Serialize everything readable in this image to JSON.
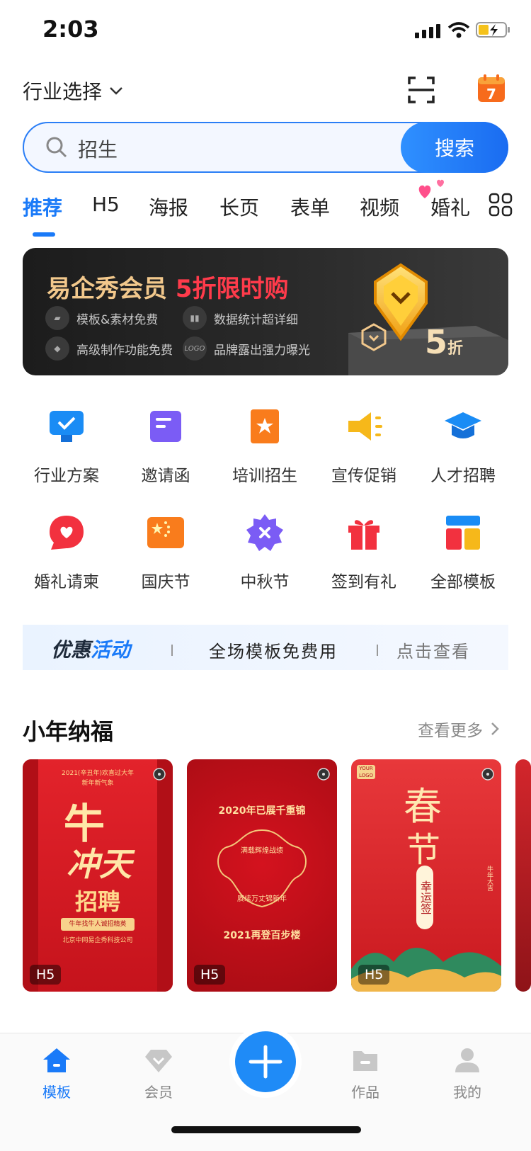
{
  "status_bar": {
    "time": "2:03"
  },
  "header": {
    "industry_label": "行业选择"
  },
  "calendar": {
    "day": "7"
  },
  "search": {
    "text": "招生",
    "button": "搜索"
  },
  "tabs": [
    "推荐",
    "H5",
    "海报",
    "长页",
    "表单",
    "视频",
    "婚礼"
  ],
  "banner": {
    "title": "易企秀会员",
    "highlight": "5折限时购",
    "features": [
      "模板&素材免费",
      "数据统计超详细",
      "高级制作功能免费",
      "品牌露出强力曝光"
    ],
    "logo_chip": "LOGO",
    "discount_number": "5",
    "discount_unit": "折"
  },
  "grid": [
    {
      "label": "行业方案",
      "icon": "monitor-check-icon",
      "color": "#1a8cf5"
    },
    {
      "label": "邀请函",
      "icon": "envelope-icon",
      "color": "#7b5cf5"
    },
    {
      "label": "培训招生",
      "icon": "star-book-icon",
      "color": "#f97c1c"
    },
    {
      "label": "宣传促销",
      "icon": "megaphone-icon",
      "color": "#f6b81a"
    },
    {
      "label": "人才招聘",
      "icon": "graduation-cap-icon",
      "color": "#1a8cf5"
    },
    {
      "label": "婚礼请柬",
      "icon": "heart-chat-icon",
      "color": "#f2313f"
    },
    {
      "label": "国庆节",
      "icon": "flag-icon",
      "color": "#f97c1c"
    },
    {
      "label": "中秋节",
      "icon": "flower-icon",
      "color": "#7b5cf5"
    },
    {
      "label": "签到有礼",
      "icon": "gift-icon",
      "color": "#f2313f"
    },
    {
      "label": "全部模板",
      "icon": "layout-icon",
      "color": "#1a8cf5"
    }
  ],
  "promo": {
    "tag_a": "优惠",
    "tag_b": "活动",
    "text": "全场模板免费用",
    "link": "点击查看"
  },
  "section": {
    "title": "小年纳福",
    "more": "查看更多"
  },
  "cards": [
    {
      "badge": "H5",
      "top": "2021(辛丑年)欢喜过大年",
      "sub": "新年新气象",
      "main_a": "牛",
      "main_b": "冲天",
      "hire": "招聘",
      "foot1": "牛年找牛人诚招精英",
      "foot2": "北京中网易企秀科技公司"
    },
    {
      "badge": "H5",
      "line1": "2020年已展千重锦",
      "center1": "满载辉煌战绩",
      "center2": "赓续万丈锦新年",
      "line2": "2021再登百步楼"
    },
    {
      "badge": "H5",
      "logo": "YOUR LOGO",
      "big_a": "春",
      "big_b": "节",
      "tag": "幸运签",
      "side": "牛年大吉"
    }
  ],
  "tabbar": [
    {
      "label": "模板",
      "icon": "home-icon",
      "active": true
    },
    {
      "label": "会员",
      "icon": "diamond-icon",
      "active": false
    },
    {
      "label": "作品",
      "icon": "folder-icon",
      "active": false
    },
    {
      "label": "我的",
      "icon": "person-icon",
      "active": false
    }
  ],
  "colors": {
    "accent": "#1a7af8",
    "banner_gold": "#f2c88c",
    "banner_red": "#ff3b4b"
  }
}
